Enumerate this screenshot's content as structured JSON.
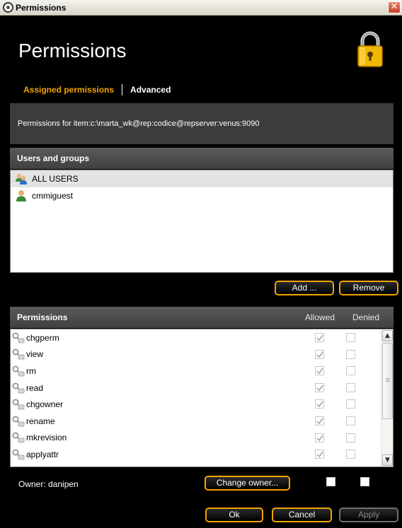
{
  "window": {
    "title": "Permissions",
    "close_label": "✕"
  },
  "header": {
    "title": "Permissions"
  },
  "tabs": [
    {
      "label": "Assigned permissions",
      "active": true
    },
    {
      "label": "Advanced",
      "active": false
    }
  ],
  "path_text": "Permissions for item:c:\\marta_wk@rep:codice@repserver:venus:9090",
  "users": {
    "header": "Users and groups",
    "items": [
      {
        "label": "ALL USERS",
        "icon": "group-icon",
        "selected": true
      },
      {
        "label": "cmmiguest",
        "icon": "user-icon",
        "selected": false
      }
    ],
    "add_label": "Add ...",
    "remove_label": "Remove"
  },
  "permissions": {
    "header": "Permissions",
    "col_allowed": "Allowed",
    "col_denied": "Denied",
    "items": [
      {
        "name": "chgperm",
        "allowed": true,
        "denied": false
      },
      {
        "name": "view",
        "allowed": true,
        "denied": false
      },
      {
        "name": "rm",
        "allowed": true,
        "denied": false
      },
      {
        "name": "read",
        "allowed": true,
        "denied": false
      },
      {
        "name": "chgowner",
        "allowed": true,
        "denied": false
      },
      {
        "name": "rename",
        "allowed": true,
        "denied": false
      },
      {
        "name": "mkrevision",
        "allowed": true,
        "denied": false
      },
      {
        "name": "applyattr",
        "allowed": true,
        "denied": false
      }
    ]
  },
  "footer": {
    "owner_label": "Owner: danipen",
    "change_owner_label": "Change owner...",
    "ok_label": "Ok",
    "cancel_label": "Cancel",
    "apply_label": "Apply"
  },
  "colors": {
    "accent": "#f0a500",
    "background": "#000000",
    "panel": "#3c3c3c"
  }
}
